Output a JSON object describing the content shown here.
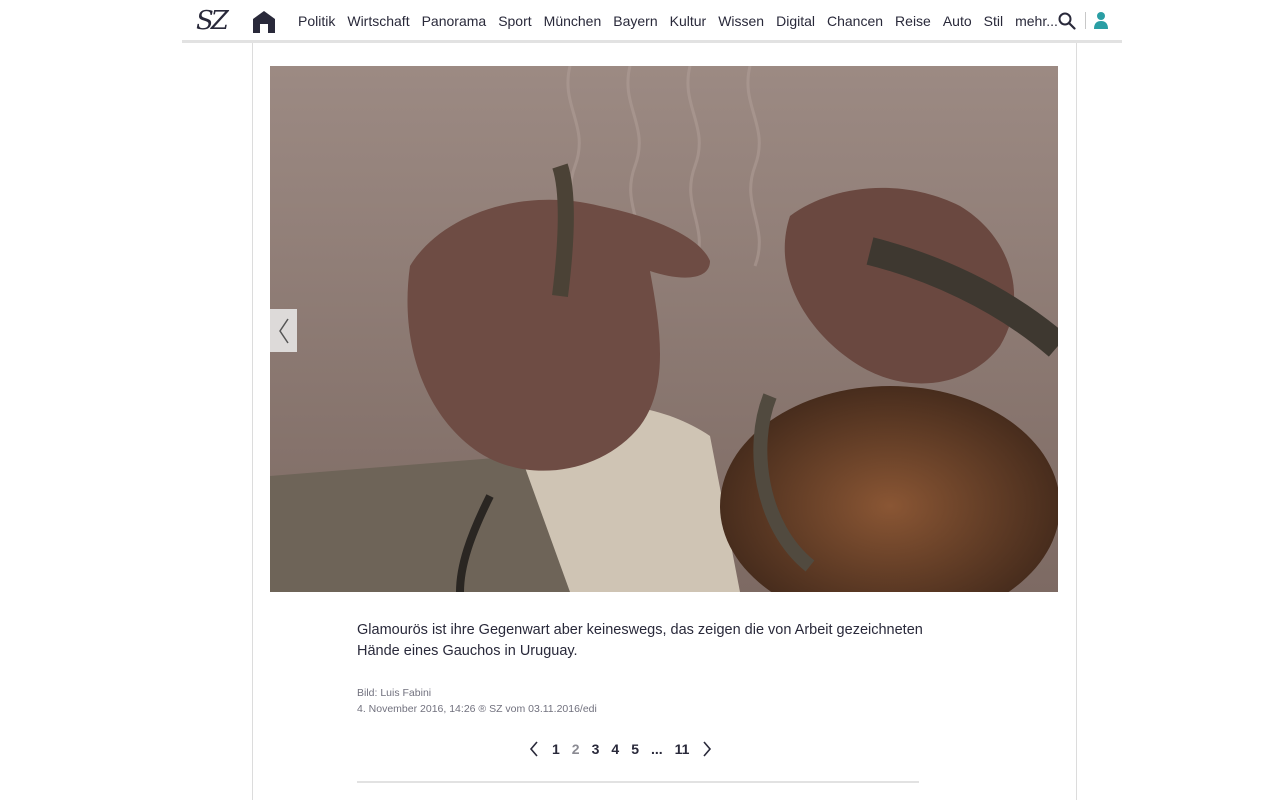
{
  "header": {
    "logo": "SZ",
    "nav": [
      "Politik",
      "Wirtschaft",
      "Panorama",
      "Sport",
      "München",
      "Bayern",
      "Kultur",
      "Wissen",
      "Digital",
      "Chancen",
      "Reise",
      "Auto",
      "Stil",
      "mehr..."
    ],
    "accent_color": "#2a9ea4"
  },
  "gallery": {
    "caption": "Glamourös ist ihre Gegenwart aber keineswegs, das zeigen die von Arbeit gezeichneten Hände eines Gauchos in Uruguay.",
    "credit": "Bild: Luis Fabini",
    "dateline": "4. November 2016, 14:26 ® SZ vom 03.11.2016/edi",
    "pages": [
      "1",
      "2",
      "3",
      "4",
      "5",
      "...",
      "11"
    ],
    "current_page": "2"
  }
}
